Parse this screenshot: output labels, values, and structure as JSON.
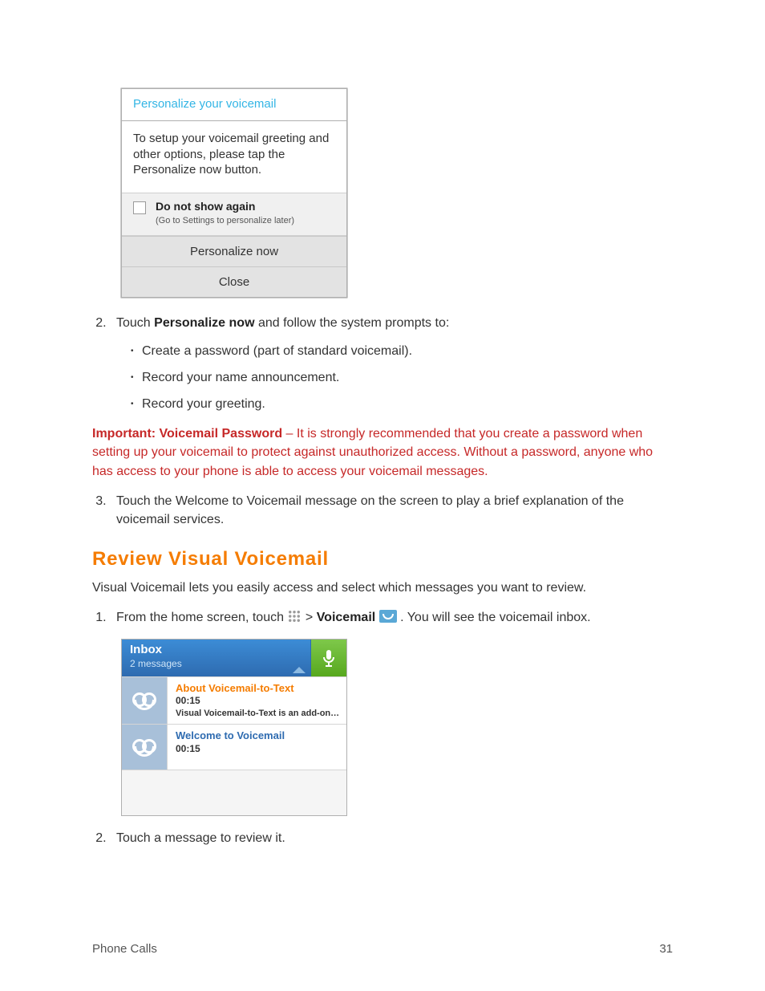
{
  "dialog": {
    "title": "Personalize your voicemail",
    "message": "To setup your voicemail greeting and other options, please tap the Personalize now button.",
    "checkbox_label": "Do not show again",
    "checkbox_hint": "(Go to Settings to personalize later)",
    "primary_btn": "Personalize now",
    "secondary_btn": "Close"
  },
  "step2": {
    "lead": "Touch ",
    "bold": "Personalize now",
    "tail": " and follow the system prompts to:",
    "bullets": [
      "Create a password (part of standard voicemail).",
      "Record your name announcement.",
      "Record your greeting."
    ]
  },
  "warning": {
    "lead": "Important: Voicemail Password",
    "body": " – It is strongly recommended that you create a password when setting up your voicemail to protect against unauthorized access. Without a password, anyone who has access to your phone is able to access your voicemail messages."
  },
  "step3": "Touch the Welcome to Voicemail message on the screen to play a brief explanation of the voicemail services.",
  "section_heading": "Review Visual Voicemail",
  "section_intro": "Visual Voicemail lets you easily access and select which messages you want to review.",
  "review_step1": {
    "pre": "From the home screen, touch ",
    "mid": " > ",
    "bold": "Voicemail",
    "post": ". You will see the voicemail inbox."
  },
  "inbox": {
    "title": "Inbox",
    "subtitle": "2 messages",
    "rows": [
      {
        "title": "About Voicemail-to-Text",
        "time": "00:15",
        "preview": "Visual Voicemail-to-Text is an add-on…",
        "titleClass": "orange"
      },
      {
        "title": "Welcome to Voicemail",
        "time": "00:15",
        "preview": "",
        "titleClass": "blue"
      }
    ]
  },
  "review_step2": "Touch a message to review it.",
  "footer": {
    "left": "Phone Calls",
    "right": "31"
  }
}
